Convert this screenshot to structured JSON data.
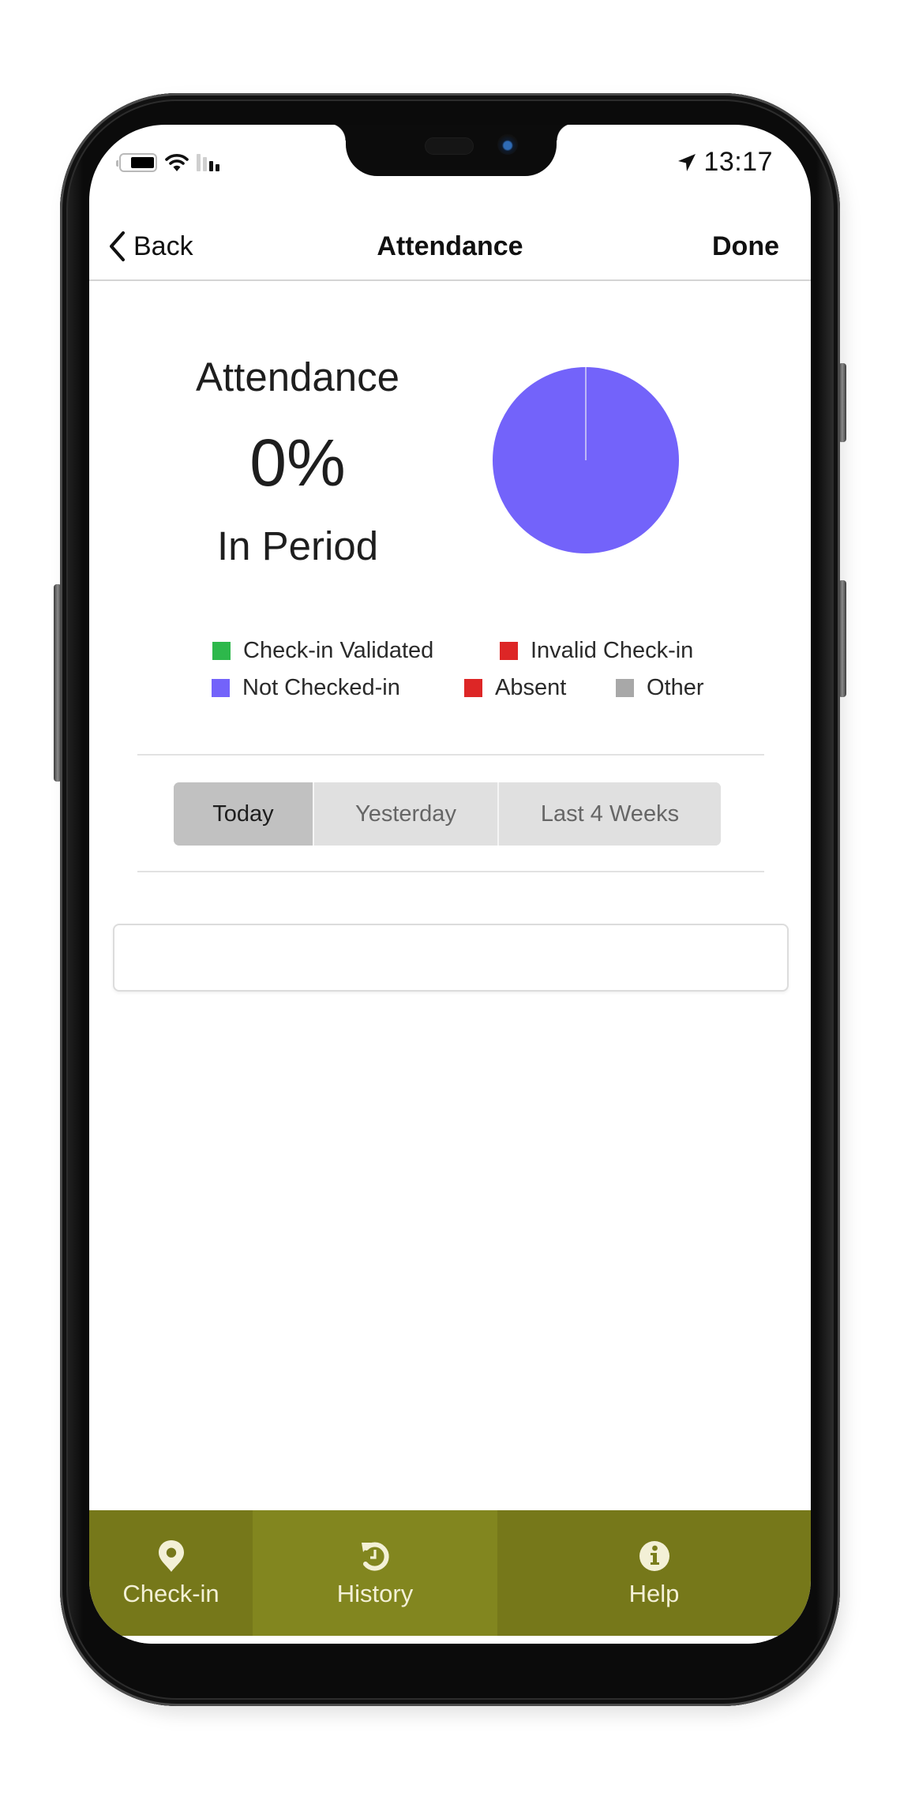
{
  "status_bar": {
    "time": "13:17",
    "icons": [
      "battery-icon",
      "wifi-icon",
      "cellular-signal-icon",
      "location-arrow-icon"
    ]
  },
  "navbar": {
    "back_label": "Back",
    "title": "Attendance",
    "done_label": "Done"
  },
  "summary": {
    "label": "Attendance",
    "value": "0%",
    "period": "In Period"
  },
  "chart_data": {
    "type": "pie",
    "title": "",
    "slices": [
      {
        "name": "Check-in Validated",
        "value": 0,
        "color": "#2db84b"
      },
      {
        "name": "Invalid Check-in",
        "value": 0,
        "color": "#dd2626"
      },
      {
        "name": "Not Checked-in",
        "value": 100,
        "color": "#7363fa"
      },
      {
        "name": "Absent",
        "value": 0,
        "color": "#dd2626"
      },
      {
        "name": "Other",
        "value": 0,
        "color": "#a8a8a8"
      }
    ],
    "legend_position": "bottom"
  },
  "legend": {
    "rows": [
      [
        {
          "label": "Check-in Validated",
          "color": "#2db84b"
        },
        {
          "label": "Invalid Check-in",
          "color": "#dd2626"
        }
      ],
      [
        {
          "label": "Not Checked-in",
          "color": "#7363fa"
        },
        {
          "label": "Absent",
          "color": "#dd2626"
        },
        {
          "label": "Other",
          "color": "#a8a8a8"
        }
      ]
    ]
  },
  "period_selector": {
    "segments": [
      "Today",
      "Yesterday",
      "Last 4 Weeks"
    ],
    "selected": "Today"
  },
  "details_box": {
    "value": ""
  },
  "tabbar": {
    "items": [
      {
        "label": "Check-in",
        "icon": "map-pin-icon"
      },
      {
        "label": "History",
        "icon": "history-icon"
      },
      {
        "label": "Help",
        "icon": "info-icon"
      }
    ],
    "colors": {
      "side": "#76781a",
      "middle": "#82861f",
      "foreground": "#f3f0d6"
    }
  },
  "colors": {
    "accent": "#7a7d1c",
    "text": "#1e1e1e",
    "segment_active": "#c1c1c1",
    "segment_inactive": "#e0e0e0"
  }
}
